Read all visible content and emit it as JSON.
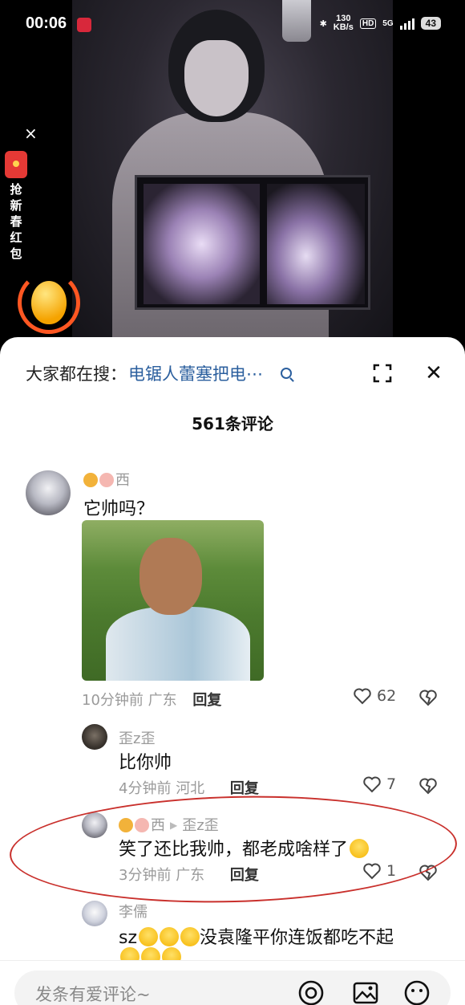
{
  "status_bar": {
    "time": "00:06",
    "speed_value": "130",
    "speed_unit": "KB/s",
    "hd": "HD",
    "network": "5G",
    "battery": "43"
  },
  "promo": {
    "close": "×",
    "label": "抢新春红包"
  },
  "search": {
    "label": "大家都在搜：",
    "term": "电锯人蕾塞把电⋯",
    "close": "✕"
  },
  "comments_count": "561条评论",
  "comments": [
    {
      "user": "西",
      "text": "它帅吗？",
      "time": "10分钟前",
      "location": "广东",
      "reply": "回复",
      "likes": "62"
    },
    {
      "user": "歪z歪",
      "text": "比你帅",
      "time": "4分钟前",
      "location": "河北",
      "reply": "回复",
      "likes": "7"
    },
    {
      "user": "西",
      "reply_to": "歪z歪",
      "text": "笑了还比我帅，都老成啥样了",
      "time": "3分钟前",
      "location": "广东",
      "reply": "回复",
      "likes": "1"
    },
    {
      "user": "李儒",
      "text": "sz",
      "text_tail": "没袁隆平你连饭都吃不起"
    }
  ],
  "input": {
    "placeholder": "发条有爱评论~"
  },
  "colors": {
    "link_blue": "#2b5f9e",
    "annotation_red": "#c9302c",
    "meta_gray": "#9a9a9a"
  }
}
